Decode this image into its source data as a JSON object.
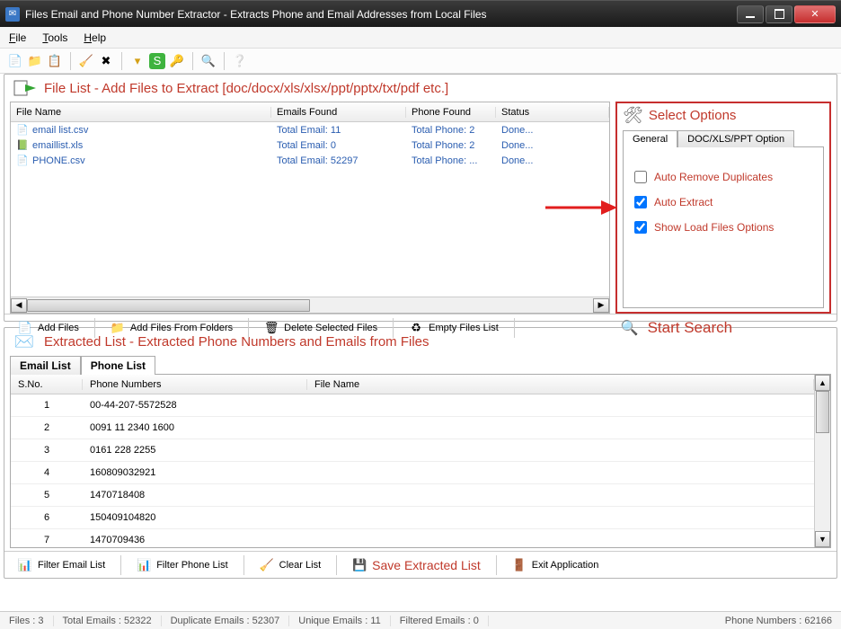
{
  "title": "Files Email and Phone Number Extractor  -  Extracts Phone and Email Addresses from Local Files",
  "menu": {
    "file": "File",
    "tools": "Tools",
    "help": "Help"
  },
  "file_list": {
    "header": "File List - Add Files to Extract  [doc/docx/xls/xlsx/ppt/pptx/txt/pdf etc.]",
    "cols": {
      "name": "File Name",
      "emails": "Emails Found",
      "phone": "Phone Found",
      "status": "Status"
    },
    "rows": [
      {
        "name": "email list.csv",
        "icon": "csv",
        "emails": "Total Email: 11",
        "phone": "Total Phone: 2",
        "status": "Done..."
      },
      {
        "name": "emaillist.xls",
        "icon": "xls",
        "emails": "Total Email: 0",
        "phone": "Total Phone: 2",
        "status": "Done..."
      },
      {
        "name": "PHONE.csv",
        "icon": "csv",
        "emails": "Total Email: 52297",
        "phone": "Total Phone: ...",
        "status": "Done..."
      }
    ],
    "actions": {
      "add_files": "Add Files",
      "add_folders": "Add Files From Folders",
      "delete_selected": "Delete Selected Files",
      "empty_list": "Empty Files List"
    }
  },
  "select_options": {
    "title": "Select Options",
    "tabs": {
      "general": "General",
      "docxls": "DOC/XLS/PPT Option"
    },
    "checks": {
      "auto_remove_dup": {
        "label": "Auto Remove Duplicates",
        "checked": false
      },
      "auto_extract": {
        "label": "Auto Extract",
        "checked": true
      },
      "show_load_opts": {
        "label": "Show Load Files Options",
        "checked": true
      }
    }
  },
  "start_search": "Start Search",
  "extracted": {
    "header": "Extracted List - Extracted Phone Numbers and Emails from Files",
    "tabs": {
      "email": "Email List",
      "phone": "Phone List"
    },
    "cols": {
      "sn": "S.No.",
      "phone": "Phone Numbers",
      "file": "File Name"
    },
    "rows": [
      {
        "sn": "1",
        "phone": "00-44-207-5572528",
        "file": ""
      },
      {
        "sn": "2",
        "phone": "0091 11 2340 1600",
        "file": ""
      },
      {
        "sn": "3",
        "phone": "0161 228 2255",
        "file": ""
      },
      {
        "sn": "4",
        "phone": "160809032921",
        "file": ""
      },
      {
        "sn": "5",
        "phone": "1470718408",
        "file": ""
      },
      {
        "sn": "6",
        "phone": "150409104820",
        "file": ""
      },
      {
        "sn": "7",
        "phone": "1470709436",
        "file": ""
      }
    ],
    "actions": {
      "filter_email": "Filter Email List",
      "filter_phone": "Filter Phone List",
      "clear_list": "Clear List",
      "save_list": "Save Extracted List",
      "exit_app": "Exit Application"
    }
  },
  "status": {
    "files": "Files :  3",
    "total_emails": "Total Emails :  52322",
    "dup_emails": "Duplicate Emails :  52307",
    "uniq_emails": "Unique Emails :  11",
    "filtered_emails": "Filtered Emails :   0",
    "phone_numbers": "Phone Numbers :   62166"
  }
}
